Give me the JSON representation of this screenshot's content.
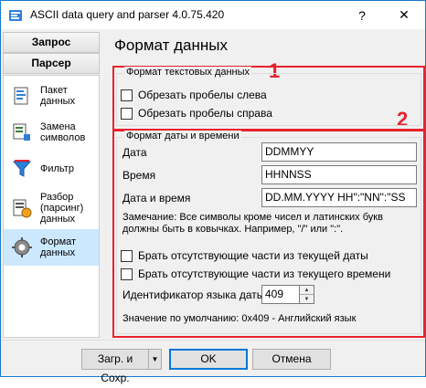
{
  "window": {
    "title": "ASCII data query and parser 4.0.75.420",
    "help_label": "?",
    "close_label": "✕"
  },
  "sidebar": {
    "tabs": [
      {
        "label": "Запрос"
      },
      {
        "label": "Парсер"
      }
    ],
    "items": [
      {
        "label": "Пакет\nданных",
        "icon": "package-icon"
      },
      {
        "label": "Замена\nсимволов",
        "icon": "replace-chars-icon"
      },
      {
        "label": "Фильтр",
        "icon": "filter-icon"
      },
      {
        "label": "Разбор\n(парсинг)\nданных",
        "icon": "parse-icon"
      },
      {
        "label": "Формат\nданных",
        "icon": "gear-icon",
        "selected": true
      }
    ]
  },
  "page": {
    "title": "Формат данных",
    "marker_1": "1",
    "marker_2": "2",
    "accent_color": "#e8222d"
  },
  "text_format": {
    "title": "Формат текстовых данных",
    "trim_left_label": "Обрезать пробелы слева",
    "trim_left_checked": false,
    "trim_right_label": "Обрезать пробелы справа",
    "trim_right_checked": false
  },
  "datetime_format": {
    "title": "Формат даты и времени",
    "date_label": "Дата",
    "date_value": "DDMMYY",
    "time_label": "Время",
    "time_value": "HHNNSS",
    "datetime_label": "Дата и время",
    "datetime_value": "DD.MM.YYYY HH\":\"NN\":\"SS",
    "note": "Замечание: Все символы кроме чисел и латинских букв должны быть в ковычках. Например, \"/\" или \":\".",
    "missing_date_label": "Брать отсутствующие части из текущей даты",
    "missing_date_checked": false,
    "missing_time_label": "Брать отсутствующие части из текущего времени",
    "missing_time_checked": false,
    "lang_id_label": "Идентификатор языка даты",
    "lang_id_value": "409",
    "default_note": "Значение по умолчанию: 0x409 - Английский язык"
  },
  "footer": {
    "load_save_label": "Загр. и Сохр.",
    "ok_label": "OK",
    "cancel_label": "Отмена"
  }
}
